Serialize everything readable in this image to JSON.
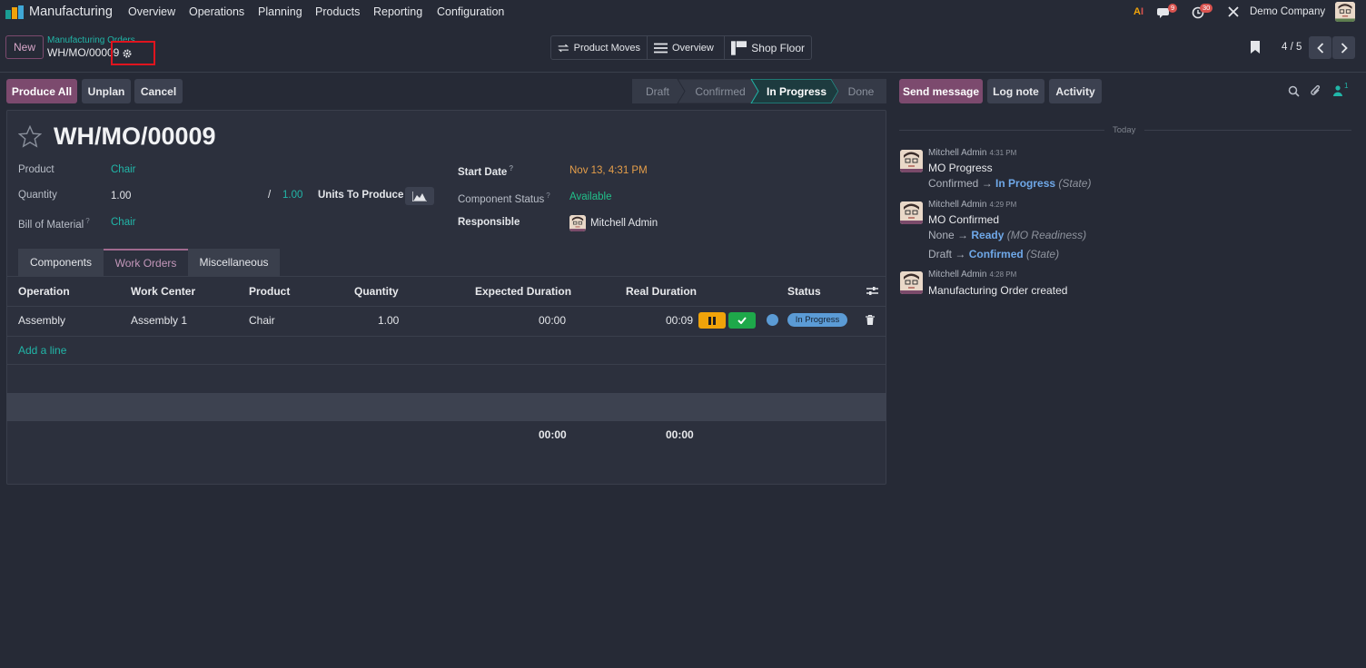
{
  "navbar": {
    "app_name": "Manufacturing",
    "menu": [
      "Overview",
      "Operations",
      "Planning",
      "Products",
      "Reporting",
      "Configuration"
    ],
    "messages_badge": "9",
    "activities_badge": "30",
    "company": "Demo Company"
  },
  "control": {
    "new_label": "New",
    "breadcrumb_parent": "Manufacturing Orders",
    "record_name": "WH/MO/00009",
    "smart_buttons": [
      "Product Moves",
      "Overview",
      "Shop Floor"
    ],
    "pager": "4 / 5"
  },
  "actions": {
    "produce_all": "Produce All",
    "unplan": "Unplan",
    "cancel": "Cancel"
  },
  "stages": [
    "Draft",
    "Confirmed",
    "In Progress",
    "Done"
  ],
  "active_stage": "In Progress",
  "chatter_buttons": {
    "send_message": "Send message",
    "log_note": "Log note",
    "activity": "Activity",
    "followers_count": "1"
  },
  "form": {
    "title": "WH/MO/00009",
    "product_label": "Product",
    "product_value": "Chair",
    "quantity_label": "Quantity",
    "quantity_value": "1.00",
    "quantity_slash": "/",
    "quantity_target": "1.00",
    "uom": "Units To Produce",
    "bom_label": "Bill of Material",
    "bom_value": "Chair",
    "start_date_label": "Start Date",
    "start_date_value": "Nov 13, 4:31 PM",
    "component_status_label": "Component Status",
    "component_status_value": "Available",
    "responsible_label": "Responsible",
    "responsible_value": "Mitchell Admin",
    "help_mark": "?"
  },
  "tabs": [
    "Components",
    "Work Orders",
    "Miscellaneous"
  ],
  "active_tab": "Work Orders",
  "work_orders": {
    "columns": [
      "Operation",
      "Work Center",
      "Product",
      "Quantity",
      "Expected Duration",
      "Real Duration",
      "Status"
    ],
    "rows": [
      {
        "operation": "Assembly",
        "work_center": "Assembly 1",
        "product": "Chair",
        "quantity": "1.00",
        "expected": "00:00",
        "real": "00:09",
        "status": "In Progress"
      }
    ],
    "add_line": "Add a line",
    "total_expected": "00:00",
    "total_real": "00:00"
  },
  "chatter": {
    "date_separator": "Today",
    "messages": [
      {
        "author": "Mitchell Admin",
        "time": "4:31 PM",
        "body": "MO Progress",
        "tracking": [
          {
            "old": "Confirmed",
            "new": "In Progress",
            "field": "(State)"
          }
        ]
      },
      {
        "author": "Mitchell Admin",
        "time": "4:29 PM",
        "body": "MO Confirmed",
        "tracking": [
          {
            "old": "None",
            "new": "Ready",
            "field": "(MO Readiness)"
          },
          {
            "old": "Draft",
            "new": "Confirmed",
            "field": "(State)"
          }
        ]
      },
      {
        "author": "Mitchell Admin",
        "time": "4:28 PM",
        "body": "Manufacturing Order created",
        "tracking": []
      }
    ],
    "arrow": "→"
  },
  "colors": {
    "background": "#262a36",
    "accent_purple": "#7c4a6e",
    "teal": "#21b6a8",
    "highlight_box": "#e0141e",
    "pause_button": "#f0a30a",
    "done_button": "#1ea84a",
    "status_badge": "#5b9bd5"
  }
}
